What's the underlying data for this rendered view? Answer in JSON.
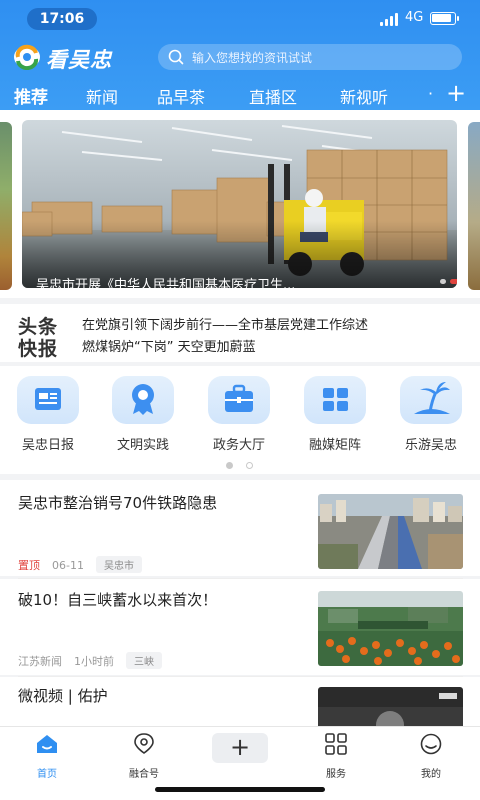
{
  "status": {
    "time": "17:06",
    "network": "4G"
  },
  "app": {
    "logo_text": "看吴忠",
    "search_placeholder": "输入您想找的资讯试试"
  },
  "tabs": [
    "推荐",
    "新闻",
    "品早茶",
    "直播区",
    "新视听"
  ],
  "banner": {
    "caption": "吴忠市开展《中华人民共和国基本医疗卫生..."
  },
  "headlines": {
    "logo_line1": "头条",
    "logo_line2": "快报",
    "items": [
      "在党旗引领下阔步前行——全市基层党建工作综述",
      "燃煤锅炉“下岗” 天空更加蔚蓝"
    ]
  },
  "services": [
    {
      "label": "吴忠日报",
      "icon": "newspaper-icon"
    },
    {
      "label": "文明实践",
      "icon": "medal-icon"
    },
    {
      "label": "政务大厅",
      "icon": "briefcase-icon"
    },
    {
      "label": "融媒矩阵",
      "icon": "grid-icon"
    },
    {
      "label": "乐游吴忠",
      "icon": "palm-island-icon"
    }
  ],
  "news": [
    {
      "title": "吴忠市整治销号70件铁路隐患",
      "top_label": "置顶",
      "date": "06-11",
      "tag": "吴忠市"
    },
    {
      "title": "破10！自三峡蓄水以来首次！",
      "source": "江苏新闻",
      "time": "1小时前",
      "tag": "三峡"
    },
    {
      "title": "微视频 | 佑护"
    }
  ],
  "bottom_nav": [
    {
      "label": "首页",
      "icon": "home-icon"
    },
    {
      "label": "融合号",
      "icon": "location-icon"
    },
    {
      "label": "服务",
      "icon": "grid-icon"
    },
    {
      "label": "我的",
      "icon": "profile-icon"
    }
  ],
  "plus_label": "+",
  "colors": {
    "brand": "#2f8ff1",
    "top_label": "#e0443e",
    "banner_dot_active": "#e0443e"
  }
}
